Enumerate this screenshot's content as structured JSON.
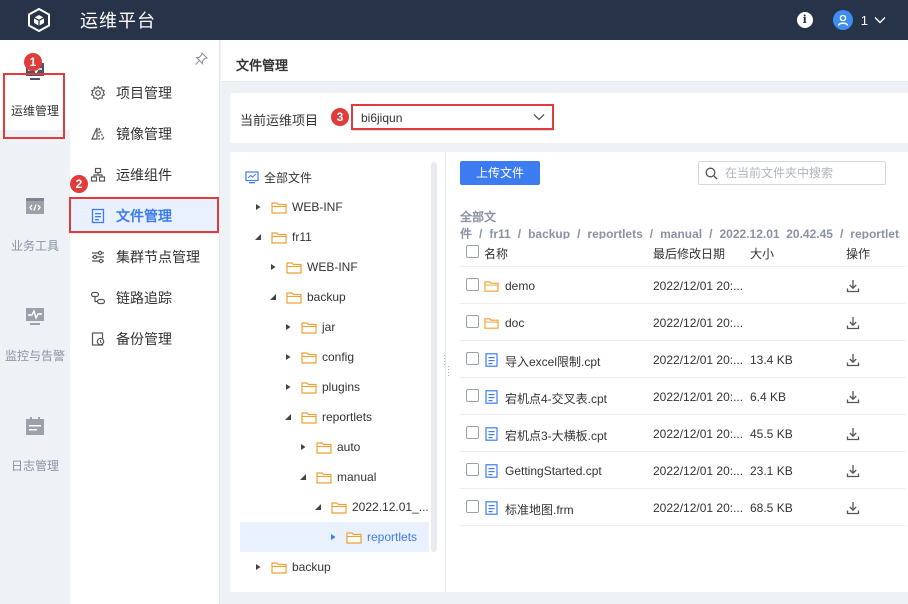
{
  "app": {
    "title": "运维平台",
    "user": "1"
  },
  "rail": [
    {
      "label": "运维管理",
      "icon": "monitor-pulse-icon"
    },
    {
      "label": "业务工具",
      "icon": "code-window-icon"
    },
    {
      "label": "监控与告警",
      "icon": "monitor-alert-icon"
    },
    {
      "label": "日志管理",
      "icon": "calendar-log-icon"
    }
  ],
  "menu": [
    {
      "label": "项目管理",
      "icon": "gear-icon"
    },
    {
      "label": "镜像管理",
      "icon": "mirror-icon"
    },
    {
      "label": "运维组件",
      "icon": "components-icon"
    },
    {
      "label": "文件管理",
      "icon": "file-icon"
    },
    {
      "label": "集群节点管理",
      "icon": "sliders-icon"
    },
    {
      "label": "链路追踪",
      "icon": "trace-icon"
    },
    {
      "label": "备份管理",
      "icon": "backup-icon"
    }
  ],
  "annotations": [
    "1",
    "2",
    "3"
  ],
  "page": {
    "title": "文件管理"
  },
  "project": {
    "label": "当前运维项目",
    "value": "bi6jiqun"
  },
  "tree": [
    {
      "label": "全部文件"
    },
    {
      "label": "WEB-INF"
    },
    {
      "label": "fr11"
    },
    {
      "label": "WEB-INF"
    },
    {
      "label": "backup"
    },
    {
      "label": "jar"
    },
    {
      "label": "config"
    },
    {
      "label": "plugins"
    },
    {
      "label": "reportlets"
    },
    {
      "label": "auto"
    },
    {
      "label": "manual"
    },
    {
      "label": "2022.12.01_..."
    },
    {
      "label": "reportlets"
    },
    {
      "label": "backup"
    }
  ],
  "toolbar": {
    "upload_label": "上传文件",
    "search_placeholder": "在当前文件夹中搜索"
  },
  "breadcrumb": [
    "全部文件",
    "fr11",
    "backup",
    "reportlets",
    "manual",
    "2022.12.01_20.42.45",
    "reportlets"
  ],
  "table": {
    "headers": {
      "name": "名称",
      "modified": "最后修改日期",
      "size": "大小",
      "action": "操作"
    },
    "rows": [
      {
        "name": "demo",
        "modified": "2022/12/01 20:...",
        "size": "",
        "type": "folder"
      },
      {
        "name": "doc",
        "modified": "2022/12/01 20:...",
        "size": "",
        "type": "folder"
      },
      {
        "name": "导入excel限制.cpt",
        "modified": "2022/12/01 20:...",
        "size": "13.4 KB",
        "type": "file"
      },
      {
        "name": "宕机点4-交叉表.cpt",
        "modified": "2022/12/01 20:...",
        "size": "6.4 KB",
        "type": "file"
      },
      {
        "name": "宕机点3-大横板.cpt",
        "modified": "2022/12/01 20:...",
        "size": "45.5 KB",
        "type": "file"
      },
      {
        "name": "GettingStarted.cpt",
        "modified": "2022/12/01 20:...",
        "size": "23.1 KB",
        "type": "file"
      },
      {
        "name": "标准地图.frm",
        "modified": "2022/12/01 20:...",
        "size": "68.5 KB",
        "type": "file"
      }
    ]
  }
}
